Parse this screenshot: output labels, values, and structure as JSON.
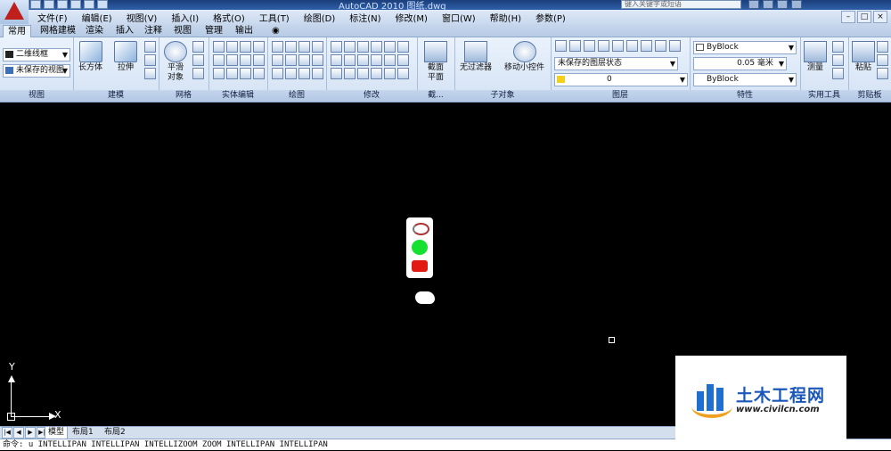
{
  "window": {
    "title": "AutoCAD 2010    图纸.dwg",
    "search_placeholder": "键入关键字或短语"
  },
  "menu": [
    "文件(F)",
    "编辑(E)",
    "视图(V)",
    "插入(I)",
    "格式(O)",
    "工具(T)",
    "绘图(D)",
    "标注(N)",
    "修改(M)",
    "窗口(W)",
    "帮助(H)",
    "参数(P)"
  ],
  "ribbon_tabs": [
    "常用",
    "网格建模",
    "渲染",
    "插入",
    "注释",
    "视图",
    "管理",
    "输出"
  ],
  "ribbon": {
    "view": {
      "visual_style": "二维线框",
      "view_state": "未保存的视图",
      "title": "视图"
    },
    "modeling": {
      "box": "长方体",
      "extrude": "拉伸",
      "title": "建模"
    },
    "mesh": {
      "smooth_object_1": "平滑",
      "smooth_object_2": "对象",
      "title": "网格"
    },
    "solid_edit": {
      "title": "实体编辑"
    },
    "draw": {
      "title": "绘图"
    },
    "modify": {
      "title": "修改"
    },
    "section": {
      "label_1": "截面",
      "label_2": "平面",
      "title": "截..."
    },
    "subobject": {
      "no_filter": "无过滤器",
      "move_gizmo": "移动小控件",
      "title": "子对象"
    },
    "layers": {
      "layer_state": "未保存的图层状态",
      "current_layer": "0",
      "title": "图层"
    },
    "properties": {
      "color": "ByBlock",
      "lineweight": "0.05 毫米",
      "linetype": "ByBlock",
      "title": "特性"
    },
    "utilities": {
      "measure": "测量",
      "title": "实用工具"
    },
    "clipboard": {
      "paste": "粘贴",
      "title": "剪贴板"
    }
  },
  "canvas": {
    "ucs_x": "X",
    "ucs_y": "Y"
  },
  "layout_tabs": [
    "模型",
    "布局1",
    "布局2"
  ],
  "command_line": "命令:  u INTELLIPAN INTELLIPAN INTELLIZOOM ZOOM INTELLIPAN INTELLIPAN",
  "watermark": {
    "title": "土木工程网",
    "url": "www.civilcn.com"
  },
  "colors": {
    "canvas_bg": "#000000",
    "ribbon_bg": "#dce8f6",
    "accent": "#1a57b8"
  }
}
